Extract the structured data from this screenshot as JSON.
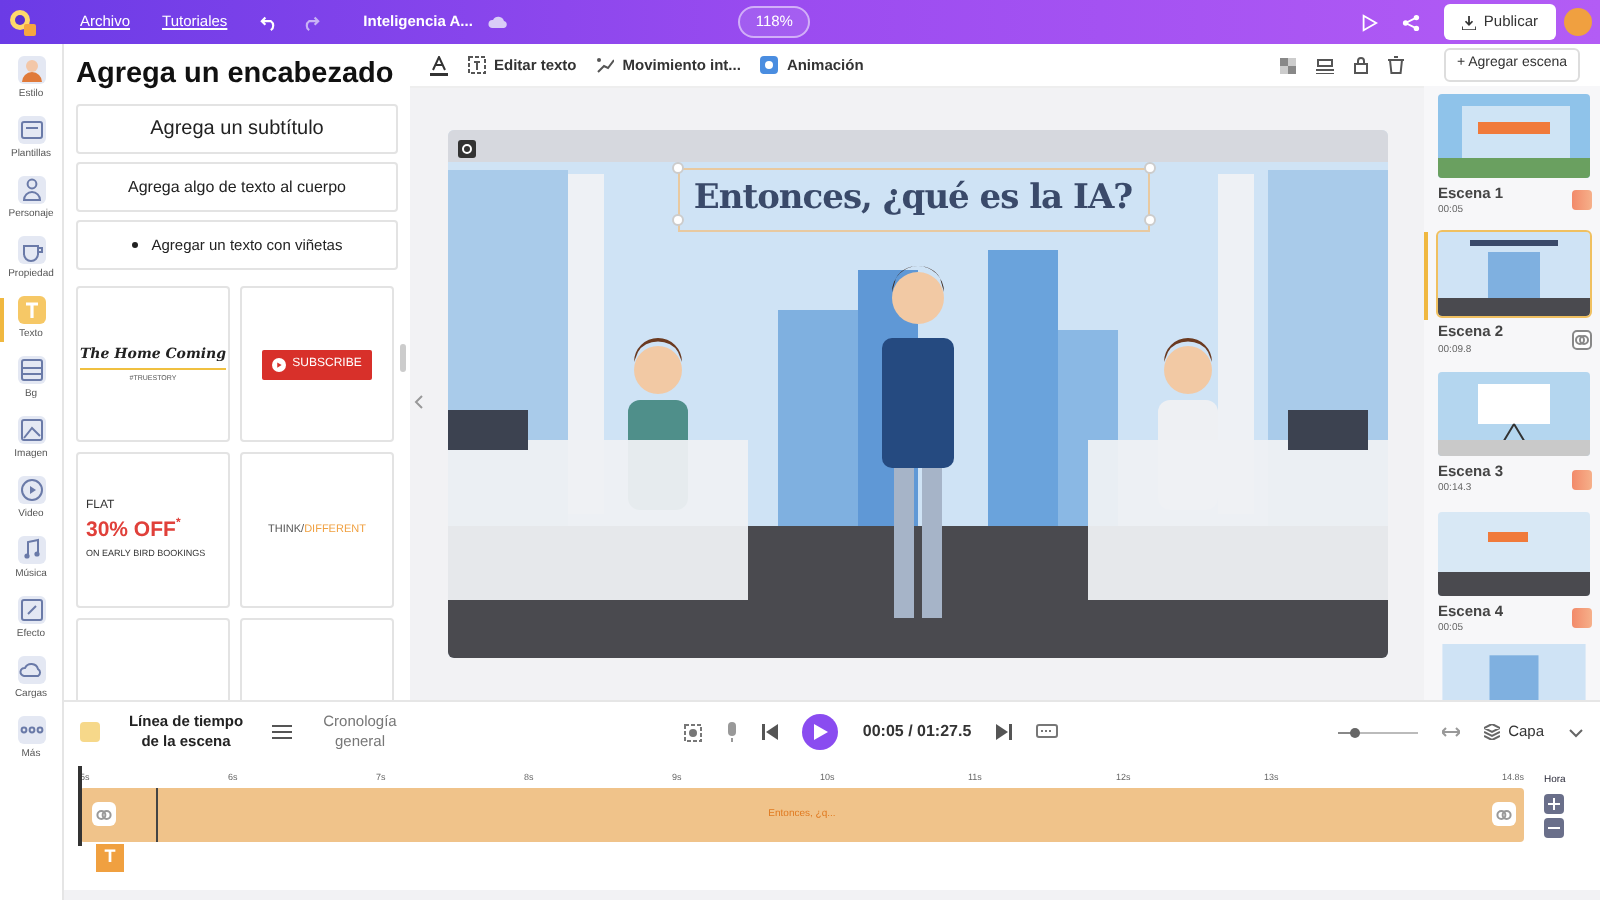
{
  "top_bar": {
    "menu": [
      {
        "label": "Archivo"
      },
      {
        "label": "Tutoriales"
      }
    ],
    "project_title": "Inteligencia A...",
    "zoom": "118%",
    "publish_button": "Publicar"
  },
  "rail": [
    {
      "label": "Estilo",
      "selected": false
    },
    {
      "label": "Plantillas",
      "selected": false
    },
    {
      "label": "Personaje",
      "selected": false
    },
    {
      "label": "Propiedad",
      "selected": false
    },
    {
      "label": "Texto",
      "selected": true
    },
    {
      "label": "Bg",
      "selected": false
    },
    {
      "label": "Imagen",
      "selected": false
    },
    {
      "label": "Video",
      "selected": false
    },
    {
      "label": "Música",
      "selected": false
    },
    {
      "label": "Efecto",
      "selected": false
    },
    {
      "label": "Cargas",
      "selected": false
    },
    {
      "label": "Más",
      "selected": false
    }
  ],
  "text_panel": {
    "heading": "Agrega un encabezado",
    "options": [
      {
        "label": "Agrega un subtítulo",
        "kind": "subtitle"
      },
      {
        "label": "Agrega algo de texto al cuerpo",
        "kind": "body"
      },
      {
        "label": "Agregar un texto con viñetas",
        "kind": "bullet"
      }
    ],
    "templates": [
      {
        "kind": "homecoming",
        "lines": [
          "The Home Coming",
          "#TRUESTORY"
        ]
      },
      {
        "kind": "subscribe",
        "lines": [
          "SUBSCRIBE"
        ]
      },
      {
        "kind": "sale",
        "lines": [
          "FLAT",
          "30% OFF",
          "*",
          "ON EARLY BIRD BOOKINGS"
        ]
      },
      {
        "kind": "think",
        "lines": [
          "THINK/",
          "DIFFERENT"
        ]
      },
      {
        "kind": "blank"
      },
      {
        "kind": "blank"
      }
    ]
  },
  "toolbar": {
    "tools": [
      {
        "label": "Editar texto"
      },
      {
        "label": "Movimiento int..."
      },
      {
        "label": "Animación"
      }
    ],
    "add_scene_button": "+ Agregar escena"
  },
  "canvas": {
    "title": "Entonces, ¿qué es la IA?"
  },
  "scenes": [
    {
      "name": "Escena 1",
      "duration": "00:05",
      "selected": false,
      "kind": "swatch"
    },
    {
      "name": "Escena 2",
      "duration": "00:09.8",
      "selected": true,
      "kind": "transition"
    },
    {
      "name": "Escena 3",
      "duration": "00:14.3",
      "selected": false,
      "kind": "swatch"
    },
    {
      "name": "Escena 4",
      "duration": "00:05",
      "selected": false,
      "kind": "swatch"
    }
  ],
  "timeline": {
    "tabs": [
      {
        "label": "Línea de tiempo de la escena",
        "selected": true
      },
      {
        "label": "Cronología general",
        "selected": false
      }
    ],
    "time": "00:05 / 01:27.5",
    "zoom_slider": {
      "level": 0.2
    },
    "layer_button": "Capa",
    "ruler": [
      "5s",
      "6s",
      "7s",
      "8s",
      "9s",
      "10s",
      "11s",
      "12s",
      "13s",
      "14.8s"
    ],
    "zoom_label": "Hora",
    "track_label": "Entonces, ¿q...",
    "text_layer_icon": "T"
  }
}
